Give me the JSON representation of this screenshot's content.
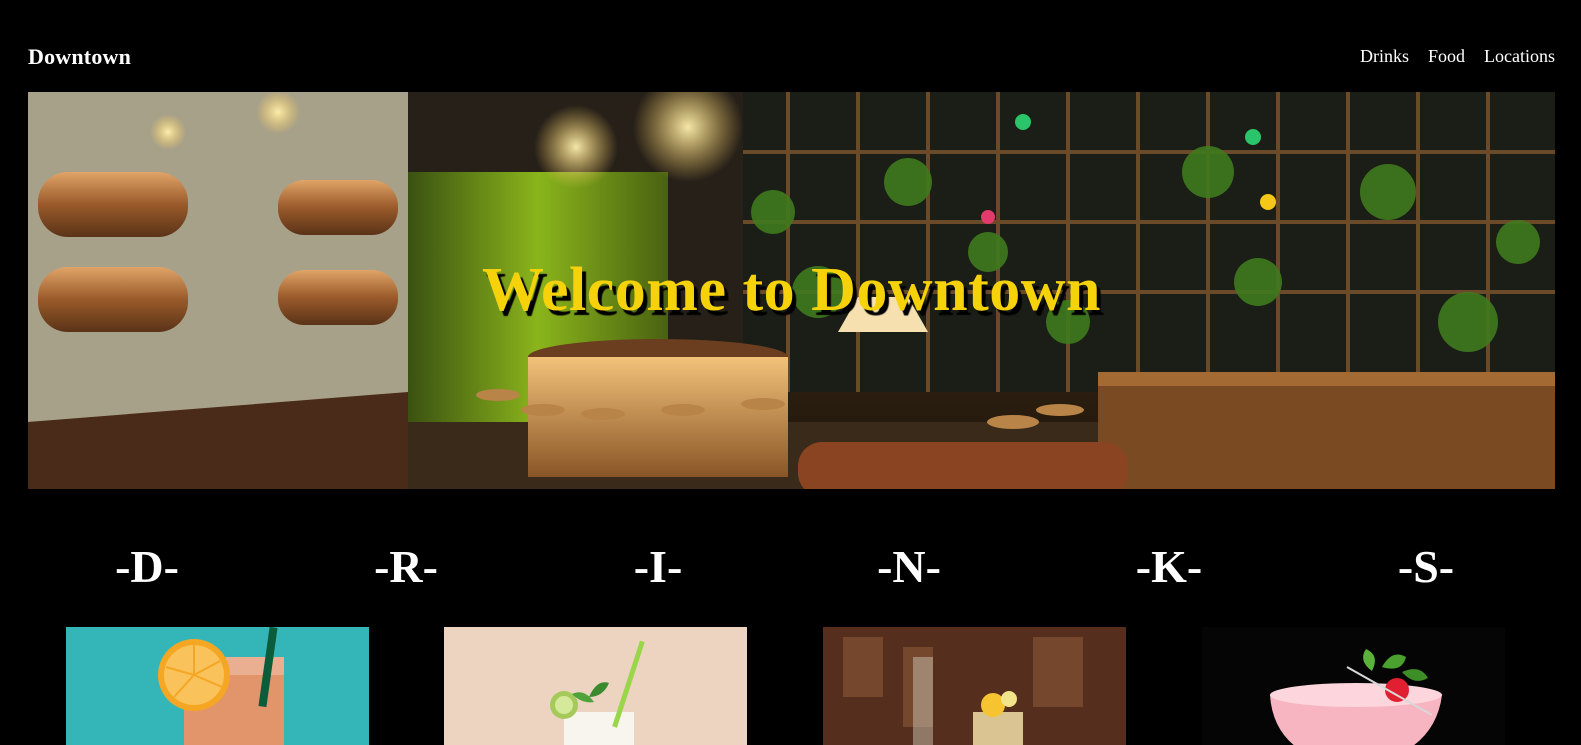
{
  "header": {
    "brand": "Downtown",
    "nav": [
      "Drinks",
      "Food",
      "Locations"
    ]
  },
  "hero": {
    "title": "Welcome to Downtown",
    "title_color": "#f5d20a"
  },
  "drinks_heading": {
    "letters": [
      "-D-",
      "-R-",
      "-I-",
      "-N-",
      "-K-",
      "-S-"
    ]
  },
  "drink_cards": [
    {
      "image": "orange-cocktail-photo"
    },
    {
      "image": "mojito-photo"
    },
    {
      "image": "bar-cocktail-photo"
    },
    {
      "image": "strawberry-cocktail-photo"
    }
  ],
  "colors": {
    "background": "#000000",
    "text": "#ffffff",
    "accent": "#f5d20a"
  }
}
